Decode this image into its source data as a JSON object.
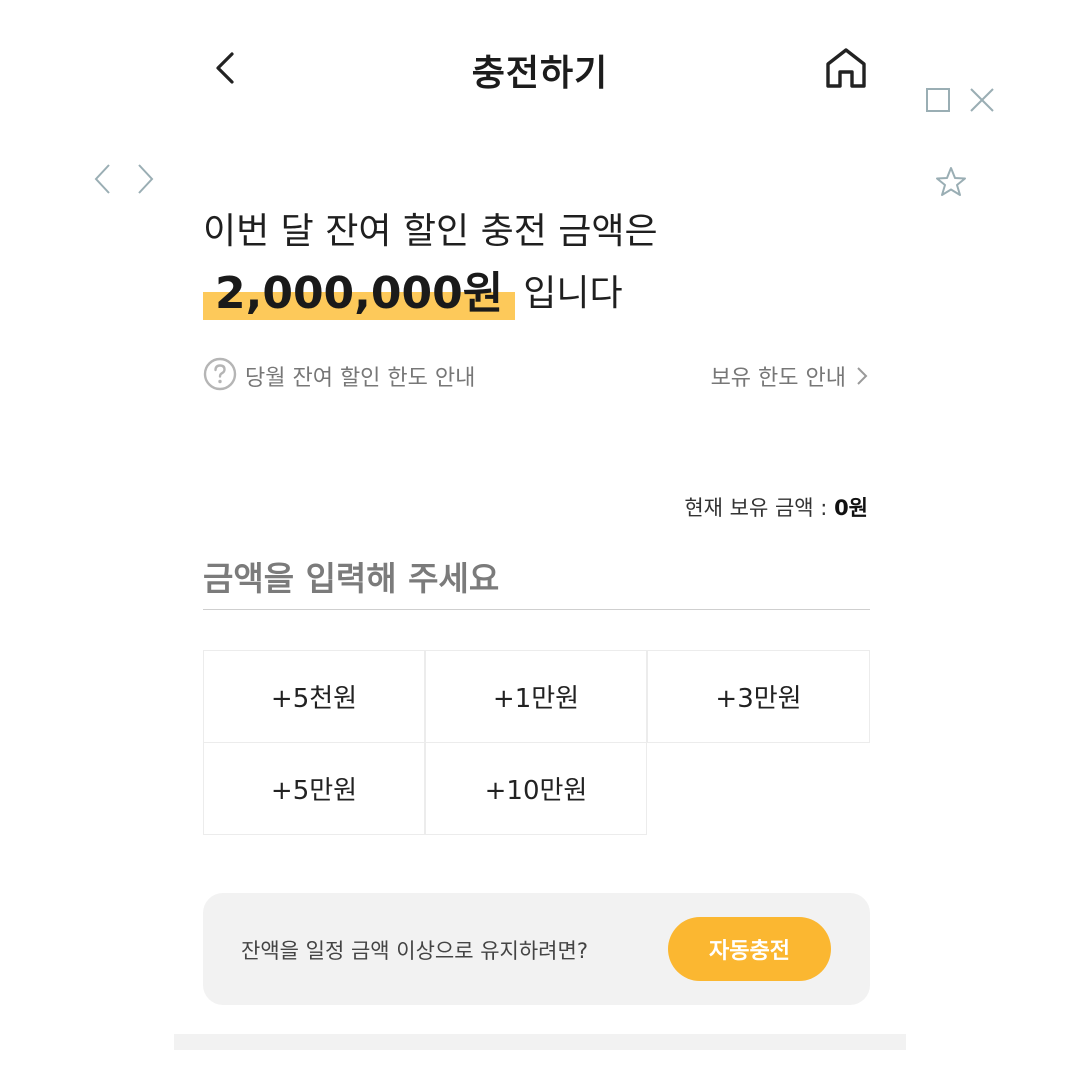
{
  "header": {
    "title": "충전하기",
    "back_icon": "chevron-left-icon",
    "home_icon": "home-icon"
  },
  "overlay_controls": {
    "icons": [
      "maximize-icon",
      "close-icon",
      "chevron-left-icon",
      "chevron-right-icon",
      "star-icon"
    ]
  },
  "headline": {
    "line1": "이번 달 잔여 할인 충전 금액은",
    "amount": "2,000,000원",
    "suffix": "입니다",
    "highlight_color": "#fdc95a"
  },
  "info": {
    "help_icon": "question-circle-icon",
    "monthly_limit_label": "당월 잔여 할인 한도 안내",
    "hold_limit_label": "보유 한도 안내"
  },
  "balance": {
    "label": "현재 보유 금액 : ",
    "value": "0원"
  },
  "amount_input": {
    "placeholder": "금액을 입력해 주세요",
    "value": ""
  },
  "quick_amounts": [
    "+5천원",
    "+1만원",
    "+3만원",
    "+5만원",
    "+10만원"
  ],
  "auto_charge": {
    "text": "잔액을 일정 금액 이상으로 유지하려면?",
    "button_label": "자동충전",
    "button_color": "#fbb731"
  }
}
